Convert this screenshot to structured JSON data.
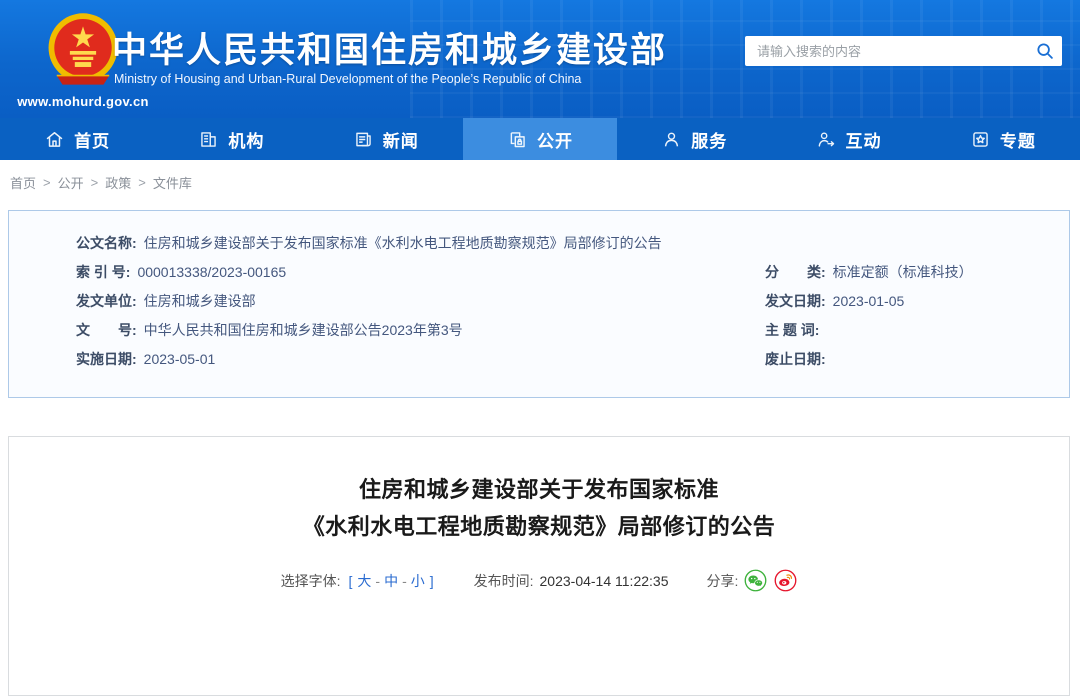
{
  "header": {
    "url": "www.mohurd.gov.cn",
    "title": "中华人民共和国住房和城乡建设部",
    "subtitle": "Ministry of Housing and Urban-Rural Development of the People’s Republic of China",
    "emblem_icon": "china-national-emblem-icon",
    "search": {
      "placeholder": "请输入搜索的内容",
      "icon": "search-icon"
    }
  },
  "nav": {
    "items": [
      {
        "label": "首页",
        "icon": "home-icon",
        "active": false
      },
      {
        "label": "机构",
        "icon": "organization-icon",
        "active": false
      },
      {
        "label": "新闻",
        "icon": "news-icon",
        "active": false
      },
      {
        "label": "公开",
        "icon": "disclosure-icon",
        "active": true
      },
      {
        "label": "服务",
        "icon": "service-icon",
        "active": false
      },
      {
        "label": "互动",
        "icon": "interaction-icon",
        "active": false
      },
      {
        "label": "专题",
        "icon": "topics-icon",
        "active": false
      }
    ]
  },
  "breadcrumb": {
    "separator": ">",
    "items": [
      "首页",
      "公开",
      "政策",
      "文件库"
    ]
  },
  "meta_card": {
    "name_row": {
      "label": "公文名称:",
      "value": "住房和城乡建设部关于发布国家标准《水利水电工程地质勘察规范》局部修订的公告"
    },
    "left_rows": [
      {
        "label": "索 引 号:",
        "value": "000013338/2023-00165"
      },
      {
        "label": "发文单位:",
        "value": "住房和城乡建设部"
      },
      {
        "label": "文　　号:",
        "value": "中华人民共和国住房和城乡建设部公告2023年第3号"
      },
      {
        "label": "实施日期:",
        "value": "2023-05-01"
      }
    ],
    "right_rows": [
      {
        "label": "分　　类:",
        "value": "标准定额（标准科技）"
      },
      {
        "label": "发文日期:",
        "value": "2023-01-05"
      },
      {
        "label": "主 题 词:",
        "value": ""
      },
      {
        "label": "废止日期:",
        "value": ""
      }
    ]
  },
  "article": {
    "title_line1": "住房和城乡建设部关于发布国家标准",
    "title_line2": "《水利水电工程地质勘察规范》局部修订的公告",
    "toolbar": {
      "font_label": "选择字体:",
      "bracket_open": "[",
      "bracket_close": "]",
      "font_sizes": [
        "大",
        "中",
        "小"
      ],
      "font_separator": "-",
      "publish_label": "发布时间:",
      "publish_time": "2023-04-14 11:22:35",
      "share_label": "分享:",
      "share_icons": [
        "wechat-icon",
        "weibo-icon"
      ]
    }
  },
  "colors": {
    "header_blue": "#0d66cc",
    "nav_blue": "#0a61c2",
    "nav_active_blue": "#3c8de0",
    "link_blue": "#2a6bd0",
    "wechat_green": "#3eb23c",
    "weibo_red": "#e6162d"
  }
}
